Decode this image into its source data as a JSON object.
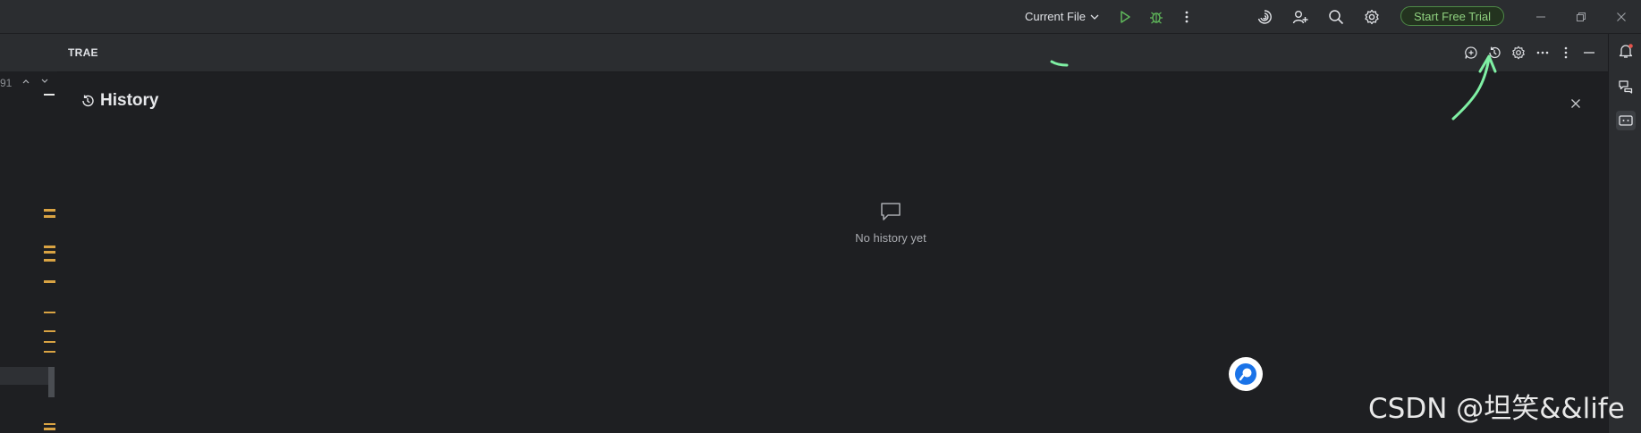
{
  "titlebar": {
    "run_config_label": "Current File",
    "trial_button_label": "Start Free Trial",
    "icons": [
      "run-icon",
      "debug-icon",
      "more-vertical-icon",
      "swirl-icon",
      "add-user-icon",
      "search-icon",
      "gear-icon",
      "minimize-icon",
      "restore-icon",
      "close-icon"
    ]
  },
  "editor_gutter": {
    "line_number": "91"
  },
  "panel": {
    "title": "TRAE",
    "header_icons": [
      "new-chat-icon",
      "history-icon",
      "settings-icon",
      "ellipsis-icon",
      "more-vertical-icon",
      "minimize-icon"
    ]
  },
  "history": {
    "title": "History",
    "empty_message": "No history yet"
  },
  "right_bar": {
    "icons": [
      "notification-bell-icon",
      "chat-bubbles-icon",
      "chat-panel-icon"
    ]
  },
  "watermark": "CSDN @坦笑&&life",
  "colors": {
    "background": "#1e1f22",
    "toolbar": "#2b2d30",
    "trial_border": "#4e8a47",
    "run_green": "#5fb85a",
    "gutter_marker": "#d9a343",
    "annotation": "#7ff0a4",
    "fab_blue": "#1a73e8"
  }
}
